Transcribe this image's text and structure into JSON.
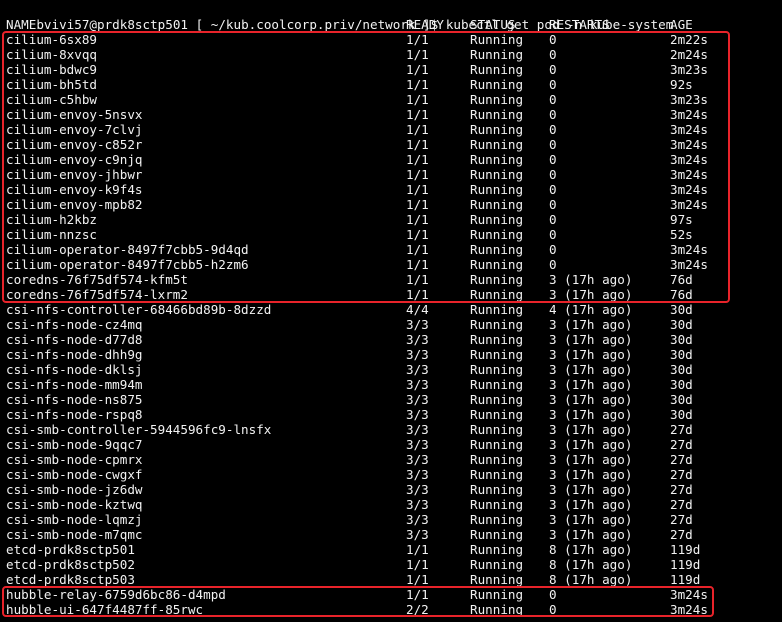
{
  "prompt": {
    "user_host": "bvivi57@prdk8sctp501",
    "path_prefix": "[ ~/kub.coolcorp.priv/network ]$ ",
    "command": "kubectl get pod -n kube-system"
  },
  "headers": {
    "name": "NAME",
    "ready": "READY",
    "status": "STATUS",
    "restarts": "RESTARTS",
    "age": "AGE"
  },
  "rows": [
    {
      "name": "cilium-6sx89",
      "ready": "1/1",
      "status": "Running",
      "restarts": "0",
      "age": "2m22s"
    },
    {
      "name": "cilium-8xvqq",
      "ready": "1/1",
      "status": "Running",
      "restarts": "0",
      "age": "2m24s"
    },
    {
      "name": "cilium-bdwc9",
      "ready": "1/1",
      "status": "Running",
      "restarts": "0",
      "age": "3m23s"
    },
    {
      "name": "cilium-bh5td",
      "ready": "1/1",
      "status": "Running",
      "restarts": "0",
      "age": "92s"
    },
    {
      "name": "cilium-c5hbw",
      "ready": "1/1",
      "status": "Running",
      "restarts": "0",
      "age": "3m23s"
    },
    {
      "name": "cilium-envoy-5nsvx",
      "ready": "1/1",
      "status": "Running",
      "restarts": "0",
      "age": "3m24s"
    },
    {
      "name": "cilium-envoy-7clvj",
      "ready": "1/1",
      "status": "Running",
      "restarts": "0",
      "age": "3m24s"
    },
    {
      "name": "cilium-envoy-c852r",
      "ready": "1/1",
      "status": "Running",
      "restarts": "0",
      "age": "3m24s"
    },
    {
      "name": "cilium-envoy-c9njq",
      "ready": "1/1",
      "status": "Running",
      "restarts": "0",
      "age": "3m24s"
    },
    {
      "name": "cilium-envoy-jhbwr",
      "ready": "1/1",
      "status": "Running",
      "restarts": "0",
      "age": "3m24s"
    },
    {
      "name": "cilium-envoy-k9f4s",
      "ready": "1/1",
      "status": "Running",
      "restarts": "0",
      "age": "3m24s"
    },
    {
      "name": "cilium-envoy-mpb82",
      "ready": "1/1",
      "status": "Running",
      "restarts": "0",
      "age": "3m24s"
    },
    {
      "name": "cilium-h2kbz",
      "ready": "1/1",
      "status": "Running",
      "restarts": "0",
      "age": "97s"
    },
    {
      "name": "cilium-nnzsc",
      "ready": "1/1",
      "status": "Running",
      "restarts": "0",
      "age": "52s"
    },
    {
      "name": "cilium-operator-8497f7cbb5-9d4qd",
      "ready": "1/1",
      "status": "Running",
      "restarts": "0",
      "age": "3m24s"
    },
    {
      "name": "cilium-operator-8497f7cbb5-h2zm6",
      "ready": "1/1",
      "status": "Running",
      "restarts": "0",
      "age": "3m24s"
    },
    {
      "name": "coredns-76f75df574-kfm5t",
      "ready": "1/1",
      "status": "Running",
      "restarts": "3 (17h ago)",
      "age": "76d"
    },
    {
      "name": "coredns-76f75df574-lxrm2",
      "ready": "1/1",
      "status": "Running",
      "restarts": "3 (17h ago)",
      "age": "76d"
    },
    {
      "name": "csi-nfs-controller-68466bd89b-8dzzd",
      "ready": "4/4",
      "status": "Running",
      "restarts": "4 (17h ago)",
      "age": "30d"
    },
    {
      "name": "csi-nfs-node-cz4mq",
      "ready": "3/3",
      "status": "Running",
      "restarts": "3 (17h ago)",
      "age": "30d"
    },
    {
      "name": "csi-nfs-node-d77d8",
      "ready": "3/3",
      "status": "Running",
      "restarts": "3 (17h ago)",
      "age": "30d"
    },
    {
      "name": "csi-nfs-node-dhh9g",
      "ready": "3/3",
      "status": "Running",
      "restarts": "3 (17h ago)",
      "age": "30d"
    },
    {
      "name": "csi-nfs-node-dklsj",
      "ready": "3/3",
      "status": "Running",
      "restarts": "3 (17h ago)",
      "age": "30d"
    },
    {
      "name": "csi-nfs-node-mm94m",
      "ready": "3/3",
      "status": "Running",
      "restarts": "3 (17h ago)",
      "age": "30d"
    },
    {
      "name": "csi-nfs-node-ns875",
      "ready": "3/3",
      "status": "Running",
      "restarts": "3 (17h ago)",
      "age": "30d"
    },
    {
      "name": "csi-nfs-node-rspq8",
      "ready": "3/3",
      "status": "Running",
      "restarts": "3 (17h ago)",
      "age": "30d"
    },
    {
      "name": "csi-smb-controller-5944596fc9-lnsfx",
      "ready": "3/3",
      "status": "Running",
      "restarts": "3 (17h ago)",
      "age": "27d"
    },
    {
      "name": "csi-smb-node-9qqc7",
      "ready": "3/3",
      "status": "Running",
      "restarts": "3 (17h ago)",
      "age": "27d"
    },
    {
      "name": "csi-smb-node-cpmrx",
      "ready": "3/3",
      "status": "Running",
      "restarts": "3 (17h ago)",
      "age": "27d"
    },
    {
      "name": "csi-smb-node-cwgxf",
      "ready": "3/3",
      "status": "Running",
      "restarts": "3 (17h ago)",
      "age": "27d"
    },
    {
      "name": "csi-smb-node-jz6dw",
      "ready": "3/3",
      "status": "Running",
      "restarts": "3 (17h ago)",
      "age": "27d"
    },
    {
      "name": "csi-smb-node-kztwq",
      "ready": "3/3",
      "status": "Running",
      "restarts": "3 (17h ago)",
      "age": "27d"
    },
    {
      "name": "csi-smb-node-lqmzj",
      "ready": "3/3",
      "status": "Running",
      "restarts": "3 (17h ago)",
      "age": "27d"
    },
    {
      "name": "csi-smb-node-m7qmc",
      "ready": "3/3",
      "status": "Running",
      "restarts": "3 (17h ago)",
      "age": "27d"
    },
    {
      "name": "etcd-prdk8sctp501",
      "ready": "1/1",
      "status": "Running",
      "restarts": "8 (17h ago)",
      "age": "119d"
    },
    {
      "name": "etcd-prdk8sctp502",
      "ready": "1/1",
      "status": "Running",
      "restarts": "8 (17h ago)",
      "age": "119d"
    },
    {
      "name": "etcd-prdk8sctp503",
      "ready": "1/1",
      "status": "Running",
      "restarts": "8 (17h ago)",
      "age": "119d"
    },
    {
      "name": "hubble-relay-6759d6bc86-d4mpd",
      "ready": "1/1",
      "status": "Running",
      "restarts": "0",
      "age": "3m24s"
    },
    {
      "name": "hubble-ui-647f4487ff-85rwc",
      "ready": "2/2",
      "status": "Running",
      "restarts": "0",
      "age": "3m24s"
    }
  ],
  "colors": {
    "background": "#000000",
    "text": "#f2f2f2",
    "highlight_box": "#e8232a"
  }
}
